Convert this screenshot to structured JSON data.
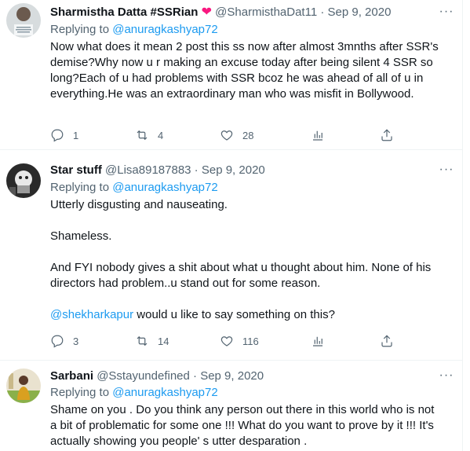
{
  "tweets": [
    {
      "name": "Sharmistha Datta #SSRian",
      "badge": "heart",
      "handle": "@SharmisthaDat11",
      "dot": "·",
      "date": "Sep 9, 2020",
      "replying_label": "Replying to",
      "replying_to": "@anuragkashyap72",
      "paragraphs": [
        "Now what does it mean 2 post this ss now after almost 3mnths after SSR's demise?Why now u r making an excuse today after being silent 4 SSR so long?Each of u had problems with SSR bcoz he was ahead of all of u in everything.He was an extraordinary man who was misfit in Bollywood."
      ],
      "replies": "1",
      "retweets": "4",
      "likes": "28"
    },
    {
      "name": "Star stuff",
      "handle": "@Lisa89187883",
      "dot": "·",
      "date": "Sep 9, 2020",
      "replying_label": "Replying to",
      "replying_to": "@anuragkashyap72",
      "paragraphs": [
        "Utterly disgusting and nauseating.",
        "Shameless.",
        "And FYI nobody gives a shit about what u thought about him. None of his directors had problem..u stand out for some reason."
      ],
      "mention": "@shekharkapur",
      "mention_text": " would u like to say something on this?",
      "replies": "3",
      "retweets": "14",
      "likes": "116"
    },
    {
      "name": "Sarbani",
      "handle": "@Sstayundefined",
      "dot": "·",
      "date": "Sep 9, 2020",
      "replying_label": "Replying to",
      "replying_to": "@anuragkashyap72",
      "paragraphs": [
        "Shame on you . Do you think any person out there in this world who is not a bit of problematic for some one !!! What do you want to prove by it !!! It's actually showing you people' s utter desparation ."
      ]
    }
  ],
  "icons": {
    "reply": "reply-icon",
    "retweet": "retweet-icon",
    "like": "like-icon",
    "views": "views-icon",
    "share": "share-icon",
    "more": "more-icon"
  },
  "colors": {
    "text": "#0f1419",
    "muted": "#536471",
    "link": "#1d9bf0",
    "heart": "#f91880",
    "divider": "#eff3f4"
  }
}
